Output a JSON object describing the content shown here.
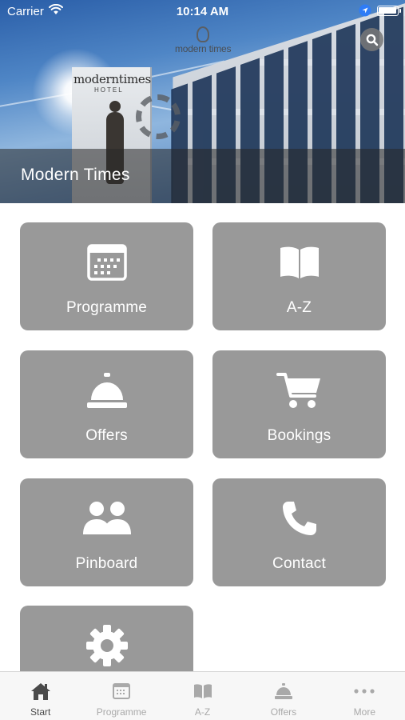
{
  "status_bar": {
    "carrier": "Carrier",
    "time": "10:14 AM",
    "battery_level": 1.0,
    "wifi_icon": "wifi-icon",
    "location_icon": "location-arrow-icon"
  },
  "hero": {
    "title": "Modern Times",
    "sign_text": "moderntimes",
    "sign_sub": "HOTEL",
    "logo_text": "modern times"
  },
  "search": {
    "icon": "search-icon"
  },
  "tiles": [
    {
      "label": "Programme",
      "icon": "calendar-icon"
    },
    {
      "label": "A-Z",
      "icon": "book-icon"
    },
    {
      "label": "Offers",
      "icon": "service-bell-icon"
    },
    {
      "label": "Bookings",
      "icon": "shopping-cart-icon"
    },
    {
      "label": "Pinboard",
      "icon": "users-icon"
    },
    {
      "label": "Contact",
      "icon": "phone-icon"
    },
    {
      "label": "",
      "icon": "gear-icon"
    }
  ],
  "tab_bar": {
    "active": "Start",
    "items": [
      {
        "label": "Start",
        "icon": "home-icon"
      },
      {
        "label": "Programme",
        "icon": "calendar-icon"
      },
      {
        "label": "A-Z",
        "icon": "book-icon"
      },
      {
        "label": "Offers",
        "icon": "service-bell-icon"
      },
      {
        "label": "More",
        "icon": "more-dots-icon"
      }
    ]
  },
  "colors": {
    "tile_background": "#999999",
    "tile_foreground": "#ffffff",
    "tab_bar_background": "#f7f7f7",
    "tab_active": "#4a4a4a",
    "tab_inactive": "#a9a9a9"
  }
}
